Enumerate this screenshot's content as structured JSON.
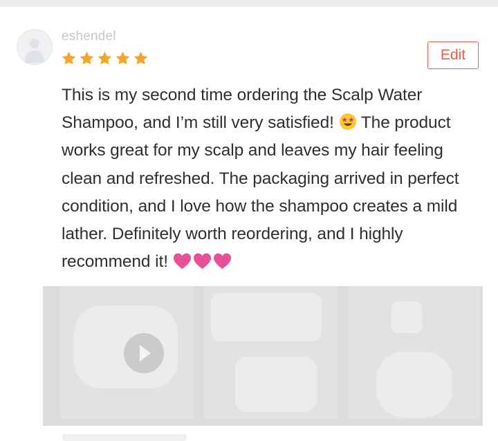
{
  "review": {
    "username": "eshendel",
    "rating": 5,
    "edit_label": "Edit",
    "text_part1": "This is my second time ordering the Scalp Water Shampoo, and I’m still very satisfied!",
    "text_part2": "The product works great for my scalp and leaves my hair feeling clean and refreshed. The packaging arrived in perfect condition, and I love how the shampoo creates a mild lather. Definitely worth reordering, and I highly recommend it!",
    "emoji": "star-struck-emoji",
    "trailing_emojis": [
      "pink-heart-icon",
      "pink-heart-icon",
      "pink-heart-icon"
    ]
  },
  "media": {
    "items": [
      {
        "type": "video",
        "icon": "play-icon"
      },
      {
        "type": "image"
      },
      {
        "type": "image"
      }
    ]
  },
  "colors": {
    "accent": "#ef5d3f",
    "star": "#f6a623",
    "heart": "#e9509a",
    "text": "#2f2f2f"
  }
}
